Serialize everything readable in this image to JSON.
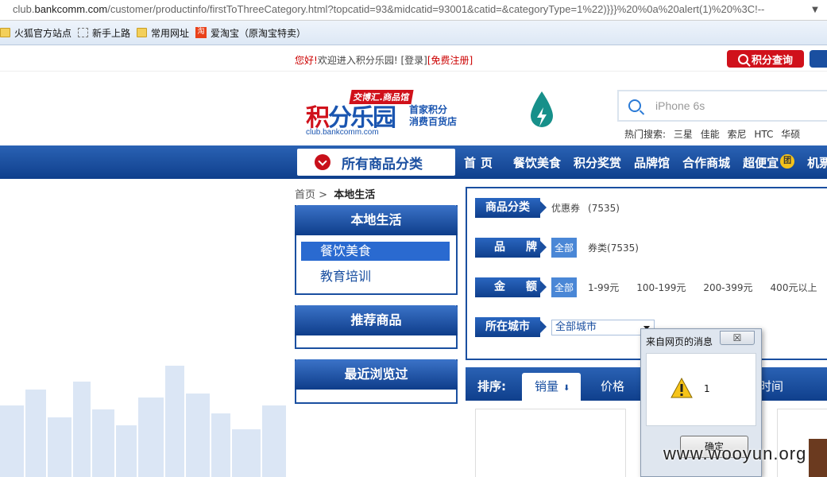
{
  "browser": {
    "url_prefix": "club.",
    "url_domain": "bankcomm.com",
    "url_rest": "/customer/productinfo/firstToThreeCategory.html?topcatid=93&midcatid=93001&catid=&categoryType=1%22)}}}%20%0a%20alert(1)%20%3C!--",
    "dropdown_glyph": "▼"
  },
  "bookmarks": [
    {
      "label": "火狐官方站点",
      "icon": "folder-icon"
    },
    {
      "label": "新手上路",
      "icon": "page-icon"
    },
    {
      "label": "常用网址",
      "icon": "folder-icon"
    },
    {
      "label": "爱淘宝（原淘宝特卖）",
      "icon": "taobao-icon",
      "icon_text": "淘"
    }
  ],
  "top": {
    "hello": "您好!",
    "welcome": "欢迎进入积分乐园!",
    "login": "[登录]",
    "register": "[免费注册]",
    "points_query": "积分查询"
  },
  "logo": {
    "tag": "交博汇.商品馆",
    "main_red": "积",
    "main_blue": "分乐园",
    "side_line1": "首家积分",
    "side_line2": "消费百货店",
    "domain": "club.bankcomm.com"
  },
  "search": {
    "placeholder": "iPhone 6s",
    "hot_label": "热门搜索:",
    "hot_terms": [
      "三星",
      "佳能",
      "索尼",
      "HTC",
      "华硕"
    ]
  },
  "nav": {
    "all_categories": "所有商品分类",
    "items": [
      "首页",
      "餐饮美食",
      "积分奖赏",
      "品牌馆",
      "合作商城",
      "超便宜",
      "机票"
    ],
    "tuan_badge": "团"
  },
  "breadcrumb": {
    "home": "首页",
    "sep": ">",
    "current": "本地生活"
  },
  "left": {
    "local_title": "本地生活",
    "local_items": [
      "餐饮美食",
      "教育培训"
    ],
    "recommend_title": "推荐商品",
    "recent_title": "最近浏览过"
  },
  "filters": {
    "category_label": "商品分类",
    "category_value": "优惠券",
    "category_count": "(7535)",
    "brand_label": "品牌",
    "all": "全部",
    "brand_option": "券类(7535)",
    "amount_label": "金额",
    "amount_options": [
      "1-99元",
      "100-199元",
      "200-399元",
      "400元以上"
    ],
    "city_label": "所在城市",
    "city_value": "全部城市"
  },
  "sort": {
    "label": "排序:",
    "active": "销量",
    "active_arrow": "⬇",
    "price": "价格",
    "time_partial": "时间"
  },
  "dialog": {
    "title": "来自网页的消息",
    "close": "☒",
    "message": "1",
    "ok": "确定"
  },
  "watermark": "www.wooyun.org",
  "colors": {
    "brand_blue": "#1a4fa0",
    "brand_red": "#d0111b"
  }
}
